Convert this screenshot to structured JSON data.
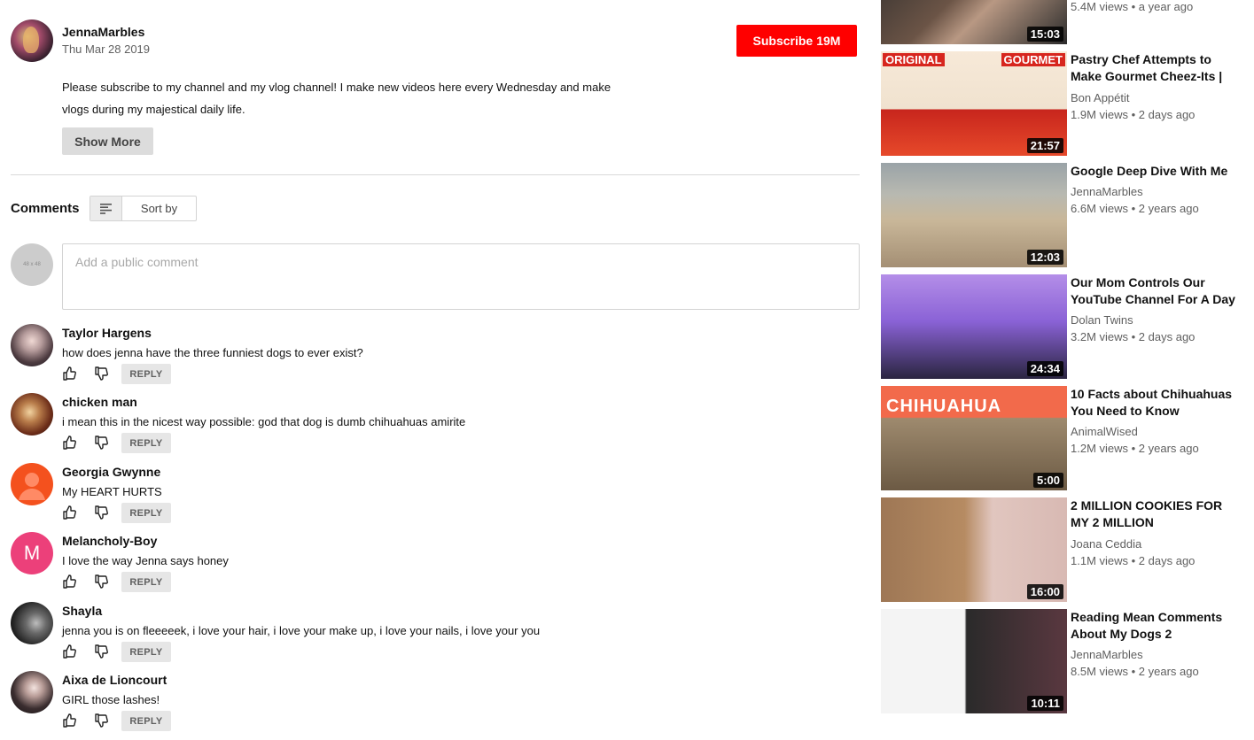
{
  "channel": {
    "name": "JennaMarbles",
    "date": "Thu Mar 28 2019",
    "subscribe_label": "Subscribe",
    "subscriber_count": "19M",
    "description": "Please subscribe to my channel and my vlog channel! I make new videos here every Wednesday and make vlogs during my majestical daily life.",
    "show_more_label": "Show More"
  },
  "comments_section": {
    "title": "Comments",
    "sort_label": "Sort by",
    "placeholder": "Add a public comment",
    "own_avatar_text": "48 x 48",
    "reply_label": "REPLY"
  },
  "comments": [
    {
      "author": "Taylor Hargens",
      "text": "how does jenna have the three funniest dogs to ever exist?"
    },
    {
      "author": "chicken man",
      "text": "i mean this in the nicest way possible: god that dog is dumb chihuahuas amirite"
    },
    {
      "author": "Georgia Gwynne",
      "text": "My HEART HURTS"
    },
    {
      "author": "Melancholy-Boy",
      "text": "I love the way Jenna says honey",
      "avatar_letter": "M"
    },
    {
      "author": "Shayla",
      "text": "jenna you is on fleeeeek, i love your hair, i love your make up, i love your nails, i love your you"
    },
    {
      "author": "Aixa de Lioncourt",
      "text": "GIRL those lashes!"
    }
  ],
  "sidebar": {
    "videos": [
      {
        "title": "",
        "channel": "",
        "meta": "5.4M views • a year ago",
        "duration": "15:03"
      },
      {
        "title": "Pastry Chef Attempts to Make Gourmet Cheez-Its |",
        "channel": "Bon Appétit",
        "meta": "1.9M views • 2 days ago",
        "duration": "21:57",
        "badge_left": "ORIGINAL",
        "badge_right": "GOURMET"
      },
      {
        "title": "Google Deep Dive With Me",
        "channel": "JennaMarbles",
        "meta": "6.6M views • 2 years ago",
        "duration": "12:03"
      },
      {
        "title": "Our Mom Controls Our YouTube Channel For A Day",
        "channel": "Dolan Twins",
        "meta": "3.2M views • 2 days ago",
        "duration": "24:34"
      },
      {
        "title": "10 Facts about Chihuahuas You Need to Know",
        "channel": "AnimalWised",
        "meta": "1.2M views • 2 years ago",
        "duration": "5:00",
        "thumb_text": "CHIHUAHUA"
      },
      {
        "title": "2 MILLION COOKIES FOR MY 2 MILLION",
        "channel": "Joana Ceddia",
        "meta": "1.1M views • 2 days ago",
        "duration": "16:00"
      },
      {
        "title": "Reading Mean Comments About My Dogs 2",
        "channel": "JennaMarbles",
        "meta": "8.5M views • 2 years ago",
        "duration": "10:11"
      }
    ]
  },
  "colors": {
    "subscribe_bg": "#ff0000",
    "reply_bg": "#e6e6e6",
    "secondary_text": "#606060"
  }
}
